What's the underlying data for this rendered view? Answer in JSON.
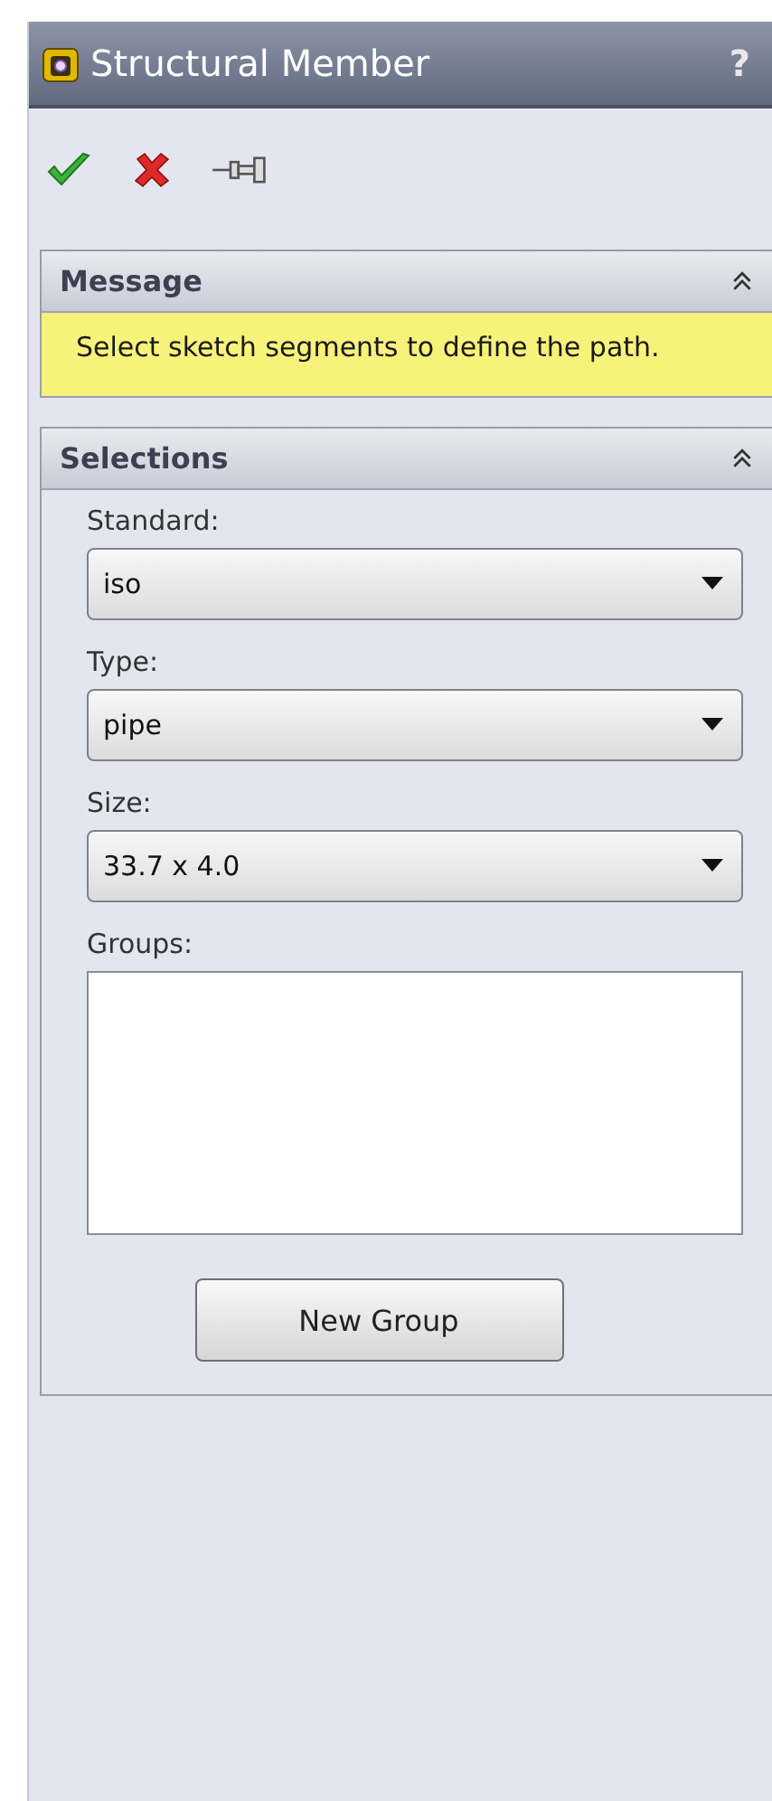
{
  "window": {
    "title": "Structural Member",
    "help": "?"
  },
  "sections": [
    {
      "kind": "message",
      "title": "Message",
      "expanded": true,
      "text": "Select sketch segments to define the path."
    },
    {
      "kind": "selections",
      "title": "Selections",
      "expanded": true,
      "fields": [
        {
          "kind": "dropdown",
          "label": "Standard:",
          "value": "iso"
        },
        {
          "kind": "dropdown",
          "label": "Type:",
          "value": "pipe"
        },
        {
          "kind": "dropdown",
          "label": "Size:",
          "value": "33.7 x 4.0"
        },
        {
          "kind": "listbox",
          "label": "Groups:"
        }
      ],
      "button": "New Group"
    }
  ]
}
